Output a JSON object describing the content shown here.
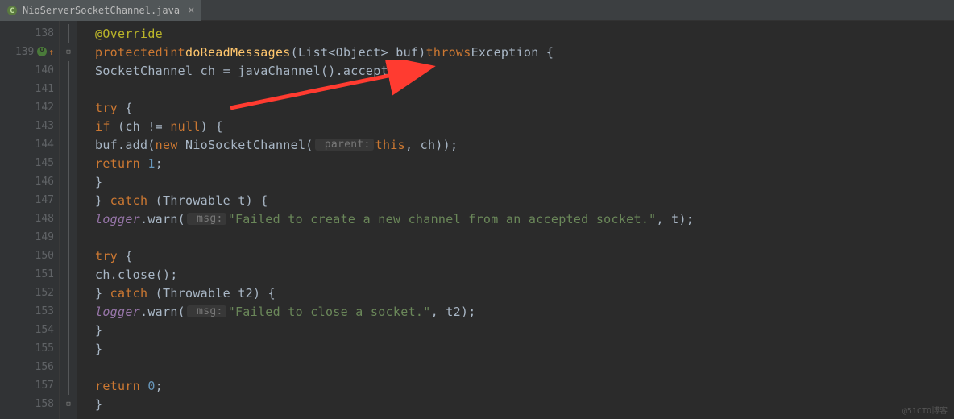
{
  "tab": {
    "filename": "NioServerSocketChannel.java"
  },
  "lines": {
    "138": "138",
    "139": "139",
    "140": "140",
    "141": "141",
    "142": "142",
    "143": "143",
    "144": "144",
    "145": "145",
    "146": "146",
    "147": "147",
    "148": "148",
    "149": "149",
    "150": "150",
    "151": "151",
    "152": "152",
    "153": "153",
    "154": "154",
    "155": "155",
    "156": "156",
    "157": "157",
    "158": "158"
  },
  "code": {
    "annotation": "@Override",
    "protected": "protected",
    "int": "int",
    "method_name": "doReadMessages",
    "param_sig": "(List<Object> buf)",
    "throws_kw": "throws",
    "exception": "Exception {",
    "line140_a": "SocketChannel ch = ",
    "line140_b": "javaChannel",
    "line140_c": "().accept();",
    "try_kw": "try",
    "brace_open": " {",
    "if_kw": "if",
    "if_cond": " (ch != ",
    "null_kw": "null",
    "if_close": ") {",
    "buf_add_a": "buf.add(",
    "new_kw": "new",
    "nsc": " NioSocketChannel(",
    "hint_parent": " parent:",
    "this_kw": "this",
    "buf_add_c": ", ch));",
    "return_kw": "return",
    "space": " ",
    "one": "1",
    "semi": ";",
    "brace_close": "}",
    "catch_kw": " catch",
    "catch1_cond": " (Throwable t) {",
    "logger": "logger",
    "warn_a": ".warn(",
    "hint_msg": " msg:",
    "str1": "\"Failed to create a new channel from an accepted socket.\"",
    "warn_b": ", t);",
    "close_a": "ch.close();",
    "catch2_cond": " (Throwable t2) {",
    "str2": "\"Failed to close a socket.\"",
    "warn_c": ", t2);",
    "zero": "0",
    "bracket_open": "(",
    "bracket_close": ")"
  },
  "watermark": "@51CTO博客"
}
